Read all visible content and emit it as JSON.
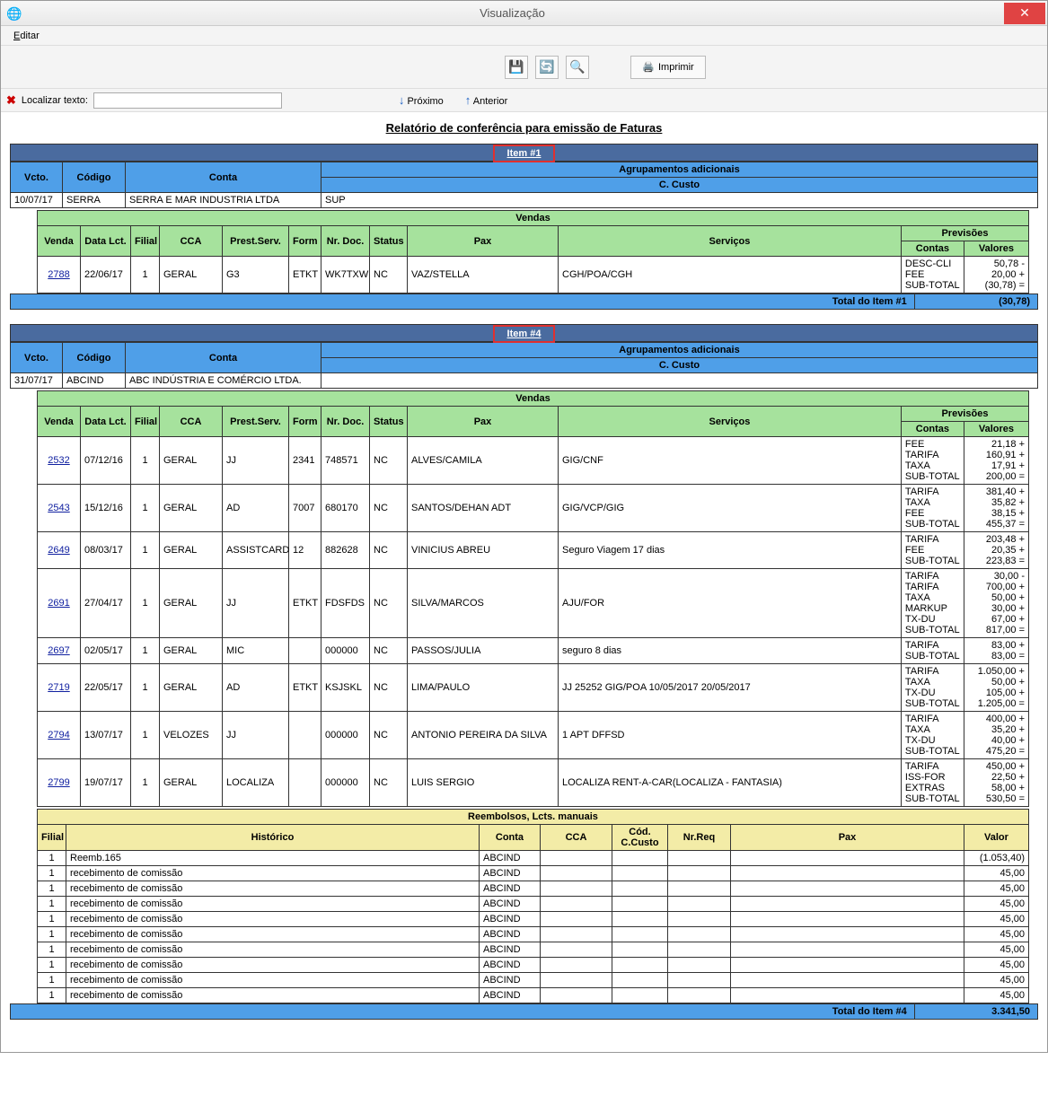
{
  "ui": {
    "title": "Visualização",
    "menu_editar": "Editar",
    "btn_imprimir": "Imprimir",
    "search_label": "Localizar texto:",
    "proximo": "Próximo",
    "anterior": "Anterior"
  },
  "report": {
    "title": "Relatório de conferência para emissão de Faturas",
    "headers": {
      "vcto": "Vcto.",
      "codigo": "Código",
      "conta": "Conta",
      "agrup": "Agrupamentos adicionais",
      "ccusto": "C. Custo"
    },
    "vendas_headers": {
      "vendas": "Vendas",
      "venda": "Venda",
      "data_lct": "Data Lct.",
      "filial": "Filial",
      "cca": "CCA",
      "prest_serv": "Prest.Serv.",
      "form": "Form",
      "nr_doc": "Nr. Doc.",
      "status": "Status",
      "pax": "Pax",
      "servicos": "Serviços",
      "previsoes": "Previsões",
      "contas": "Contas",
      "valores": "Valores"
    },
    "reemb_headers": {
      "title": "Reembolsos, Lcts. manuais",
      "filial": "Filial",
      "historico": "Histórico",
      "conta": "Conta",
      "cca": "CCA",
      "cod_ccusto": "Cód. C.Custo",
      "nr_req": "Nr.Req",
      "pax": "Pax",
      "valor": "Valor"
    }
  },
  "items": [
    {
      "label": "Item #1",
      "header": {
        "vcto": "10/07/17",
        "codigo": "SERRA",
        "conta": "SERRA E MAR INDUSTRIA LTDA",
        "agrup": "SUP"
      },
      "vendas": [
        {
          "venda": "2788",
          "data_lct": "22/06/17",
          "filial": "1",
          "cca": "GERAL",
          "prest_serv": "G3",
          "form": "ETKT",
          "nr_doc": "WK7TXW",
          "status": "NC",
          "pax": "VAZ/STELLA",
          "servicos": "CGH/POA/CGH",
          "previsoes": [
            {
              "c": "DESC-CLI",
              "v": "50,78 -"
            },
            {
              "c": "FEE",
              "v": "20,00 +"
            },
            {
              "c": "SUB-TOTAL",
              "v": "(30,78) ="
            }
          ],
          "venda_highlight": false
        }
      ],
      "total_label": "Total do Item #1",
      "total_value": "(30,78)"
    },
    {
      "label": "Item #4",
      "header": {
        "vcto": "31/07/17",
        "codigo": "ABCIND",
        "conta": "ABC INDÚSTRIA E COMÉRCIO LTDA.",
        "agrup": ""
      },
      "vendas": [
        {
          "venda": "2532",
          "data_lct": "07/12/16",
          "filial": "1",
          "cca": "GERAL",
          "prest_serv": "JJ",
          "form": "2341",
          "nr_doc": "748571",
          "status": "NC",
          "pax": "ALVES/CAMILA",
          "servicos": "GIG/CNF",
          "previsoes": [
            {
              "c": "FEE",
              "v": "21,18 +"
            },
            {
              "c": "TARIFA",
              "v": "160,91 +"
            },
            {
              "c": "TAXA",
              "v": "17,91 +"
            },
            {
              "c": "SUB-TOTAL",
              "v": "200,00 ="
            }
          ],
          "venda_highlight": true
        },
        {
          "venda": "2543",
          "data_lct": "15/12/16",
          "filial": "1",
          "cca": "GERAL",
          "prest_serv": "AD",
          "form": "7007",
          "nr_doc": "680170",
          "status": "NC",
          "pax": "SANTOS/DEHAN ADT",
          "servicos": "GIG/VCP/GIG",
          "previsoes": [
            {
              "c": "TARIFA",
              "v": "381,40 +"
            },
            {
              "c": "TAXA",
              "v": "35,82 +"
            },
            {
              "c": "FEE",
              "v": "38,15 +"
            },
            {
              "c": "SUB-TOTAL",
              "v": "455,37 ="
            }
          ],
          "venda_highlight": true
        },
        {
          "venda": "2649",
          "data_lct": "08/03/17",
          "filial": "1",
          "cca": "GERAL",
          "prest_serv": "ASSISTCARD",
          "form": "12",
          "nr_doc": "882628",
          "status": "NC",
          "pax": "VINICIUS ABREU",
          "servicos": "Seguro Viagem 17 dias",
          "previsoes": [
            {
              "c": "TARIFA",
              "v": "203,48 +"
            },
            {
              "c": "FEE",
              "v": "20,35 +"
            },
            {
              "c": "SUB-TOTAL",
              "v": "223,83 ="
            }
          ],
          "venda_highlight": true
        },
        {
          "venda": "2691",
          "data_lct": "27/04/17",
          "filial": "1",
          "cca": "GERAL",
          "prest_serv": "JJ",
          "form": "ETKT",
          "nr_doc": "FDSFDS",
          "status": "NC",
          "pax": "SILVA/MARCOS",
          "servicos": "AJU/FOR",
          "previsoes": [
            {
              "c": "TARIFA",
              "v": "30,00 -"
            },
            {
              "c": "TARIFA",
              "v": "700,00 +"
            },
            {
              "c": "TAXA",
              "v": "50,00 +"
            },
            {
              "c": "MARKUP",
              "v": "30,00 +"
            },
            {
              "c": "TX-DU",
              "v": "67,00 +"
            },
            {
              "c": "SUB-TOTAL",
              "v": "817,00 ="
            }
          ],
          "venda_highlight": true
        },
        {
          "venda": "2697",
          "data_lct": "02/05/17",
          "filial": "1",
          "cca": "GERAL",
          "prest_serv": "MIC",
          "form": "",
          "nr_doc": "000000",
          "status": "NC",
          "pax": "PASSOS/JULIA",
          "servicos": "seguro 8 dias",
          "previsoes": [
            {
              "c": "TARIFA",
              "v": "83,00 +"
            },
            {
              "c": "SUB-TOTAL",
              "v": "83,00 ="
            }
          ],
          "venda_highlight": true
        },
        {
          "venda": "2719",
          "data_lct": "22/05/17",
          "filial": "1",
          "cca": "GERAL",
          "prest_serv": "AD",
          "form": "ETKT",
          "nr_doc": "KSJSKL",
          "status": "NC",
          "pax": "LIMA/PAULO",
          "servicos": "JJ 25252 GIG/POA 10/05/2017 20/05/2017",
          "previsoes": [
            {
              "c": "TARIFA",
              "v": "1.050,00 +"
            },
            {
              "c": "TAXA",
              "v": "50,00 +"
            },
            {
              "c": "TX-DU",
              "v": "105,00 +"
            },
            {
              "c": "SUB-TOTAL",
              "v": "1.205,00 ="
            }
          ],
          "venda_highlight": true
        },
        {
          "venda": "2794",
          "data_lct": "13/07/17",
          "filial": "1",
          "cca": "VELOZES",
          "prest_serv": "JJ",
          "form": "",
          "nr_doc": "000000",
          "status": "NC",
          "pax": "ANTONIO PEREIRA DA SILVA",
          "servicos": "1 APT DFFSD",
          "previsoes": [
            {
              "c": "TARIFA",
              "v": "400,00 +"
            },
            {
              "c": "TAXA",
              "v": "35,20 +"
            },
            {
              "c": "TX-DU",
              "v": "40,00 +"
            },
            {
              "c": "SUB-TOTAL",
              "v": "475,20 ="
            }
          ],
          "venda_highlight": true
        },
        {
          "venda": "2799",
          "data_lct": "19/07/17",
          "filial": "1",
          "cca": "GERAL",
          "prest_serv": "LOCALIZA",
          "form": "",
          "nr_doc": "000000",
          "status": "NC",
          "pax": "LUIS SERGIO",
          "servicos": "LOCALIZA RENT-A-CAR(LOCALIZA - FANTASIA)",
          "previsoes": [
            {
              "c": "TARIFA",
              "v": "450,00 +"
            },
            {
              "c": "ISS-FOR",
              "v": "22,50 +"
            },
            {
              "c": "EXTRAS",
              "v": "58,00 +"
            },
            {
              "c": "SUB-TOTAL",
              "v": "530,50 ="
            }
          ],
          "venda_highlight": true
        }
      ],
      "reembolsos": [
        {
          "filial": "1",
          "historico": "Reemb.165",
          "conta": "ABCIND",
          "cca": "",
          "ccusto": "",
          "nrreq": "",
          "pax": "",
          "valor": "(1.053,40)"
        },
        {
          "filial": "1",
          "historico": "recebimento de comissão",
          "conta": "ABCIND",
          "cca": "",
          "ccusto": "",
          "nrreq": "",
          "pax": "",
          "valor": "45,00"
        },
        {
          "filial": "1",
          "historico": "recebimento de comissão",
          "conta": "ABCIND",
          "cca": "",
          "ccusto": "",
          "nrreq": "",
          "pax": "",
          "valor": "45,00"
        },
        {
          "filial": "1",
          "historico": "recebimento de comissão",
          "conta": "ABCIND",
          "cca": "",
          "ccusto": "",
          "nrreq": "",
          "pax": "",
          "valor": "45,00"
        },
        {
          "filial": "1",
          "historico": "recebimento de comissão",
          "conta": "ABCIND",
          "cca": "",
          "ccusto": "",
          "nrreq": "",
          "pax": "",
          "valor": "45,00"
        },
        {
          "filial": "1",
          "historico": "recebimento de comissão",
          "conta": "ABCIND",
          "cca": "",
          "ccusto": "",
          "nrreq": "",
          "pax": "",
          "valor": "45,00"
        },
        {
          "filial": "1",
          "historico": "recebimento de comissão",
          "conta": "ABCIND",
          "cca": "",
          "ccusto": "",
          "nrreq": "",
          "pax": "",
          "valor": "45,00"
        },
        {
          "filial": "1",
          "historico": "recebimento de comissão",
          "conta": "ABCIND",
          "cca": "",
          "ccusto": "",
          "nrreq": "",
          "pax": "",
          "valor": "45,00"
        },
        {
          "filial": "1",
          "historico": "recebimento de comissão",
          "conta": "ABCIND",
          "cca": "",
          "ccusto": "",
          "nrreq": "",
          "pax": "",
          "valor": "45,00"
        },
        {
          "filial": "1",
          "historico": "recebimento de comissão",
          "conta": "ABCIND",
          "cca": "",
          "ccusto": "",
          "nrreq": "",
          "pax": "",
          "valor": "45,00"
        }
      ],
      "total_label": "Total do Item #4",
      "total_value": "3.341,50"
    }
  ]
}
